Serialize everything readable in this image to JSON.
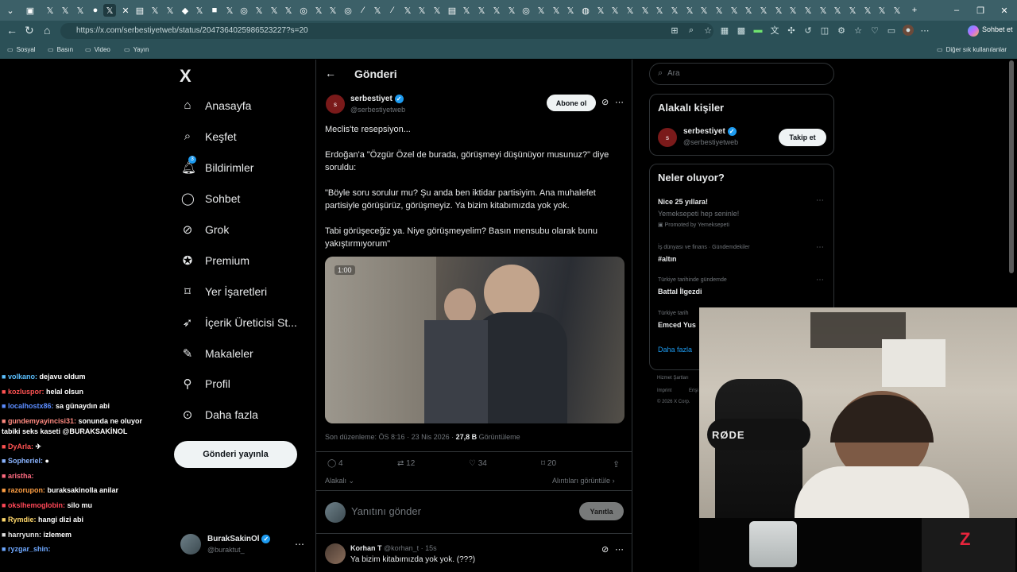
{
  "browser": {
    "url": "https://x.com/serbestiyetweb/status/2047364025986523227?s=20",
    "profile_button": "Sohbet et",
    "bookmarks": [
      "Sosyal",
      "Basın",
      "Video",
      "Yayın"
    ],
    "other_bookmarks": "Diğer sık kullanılanlar"
  },
  "nav": {
    "logo": "X",
    "items": [
      "Anasayfa",
      "Keşfet",
      "Bildirimler",
      "Sohbet",
      "Grok",
      "Premium",
      "Yer İşaretleri",
      "İçerik Üreticisi St...",
      "Makaleler",
      "Profil",
      "Daha fazla"
    ],
    "notif_badge": "3",
    "post_button": "Gönderi yayınla",
    "account_name": "BurakSakinOl",
    "account_handle": "@buraktut_"
  },
  "main": {
    "header_title": "Gönderi",
    "author_name": "serbestiyet",
    "author_handle": "@serbestiyetweb",
    "follow_button": "Abone ol",
    "text_1": "Meclis'te resepsiyon...",
    "text_2": "Erdoğan'a \"Özgür Özel de burada, görüşmeyi düşünüyor musunuz?\" diye soruldu:",
    "text_3": "\"Böyle soru sorulur mu? Şu anda ben iktidar partisiyim. Ana muhalefet partisiyle görüşürüz, görüşmeyiz. Ya bizim kitabımızda yok yok.",
    "text_4": "Tabi görüşeceğiz ya. Niye görüşmeyelim? Basın mensubu olarak bunu yakıştırmıyorum\"",
    "video_time": "1:00",
    "meta_prefix": "Son düzenleme: ÖS 8:16 · 23 Nis 2026 · ",
    "views_count": "27,8 B",
    "views_label": "Görüntüleme",
    "replies": "4",
    "reposts": "12",
    "likes": "34",
    "bookmarks": "20",
    "relevance": "Alakalı",
    "quotes_link": "Alıntıları görüntüle",
    "reply_placeholder": "Yanıtını gönder",
    "reply_button": "Yanıtla",
    "reply_author": "Korhan T",
    "reply_handle_time": "@korhan_t · 15s",
    "reply_text": "Ya bizim kitabımızda yok yok. (???)"
  },
  "right": {
    "search_placeholder": "Ara",
    "related_title": "Alakalı kişiler",
    "related_name": "serbestiyet",
    "related_handle": "@serbestiyetweb",
    "follow_button": "Takip et",
    "trends_title": "Neler oluyor?",
    "trend1_title": "Nice 25 yıllara!",
    "trend1_sub": "Yemeksepeti hep seninle!",
    "trend1_promo": "Promoted by Yemeksepeti",
    "trend2_ctx": "İş dünyası ve finans · Gündemdekiler",
    "trend2_title": "#altın",
    "trend3_ctx": "Türkiye tarihinde gündemde",
    "trend3_title": "Battal İlgezdi",
    "trend4_ctx": "Türkiye tarih",
    "trend4_title": "Emced Yus",
    "more": "Daha fazla",
    "footer1": "Hizmet Şartları",
    "footer2": "Imprint",
    "footer3": "Erişi",
    "footer4": "© 2026 X Corp."
  },
  "chat": [
    {
      "user": "volkano:",
      "msg": "dejavu oldum",
      "color": "#5bc0ff"
    },
    {
      "user": "kozluspor:",
      "msg": "helal olsun",
      "color": "#ff5252"
    },
    {
      "user": "localhostx86:",
      "msg": "sa günaydın abi",
      "color": "#5b8cff"
    },
    {
      "user": "gundemyayincisi31:",
      "msg": "sonunda ne oluyor tabiki seks kaseti @BURAKSAKİNOL",
      "color": "#ff8a80"
    },
    {
      "user": "DyArla:",
      "msg": "✈",
      "color": "#ff5252"
    },
    {
      "user": "Sopheriel:",
      "msg": "●",
      "color": "#8ab4ff"
    },
    {
      "user": "aristha:",
      "msg": "",
      "color": "#ff6b81"
    },
    {
      "user": "razorupon:",
      "msg": "buraksakinolla anilar",
      "color": "#ff9f43"
    },
    {
      "user": "okslhemoglobin:",
      "msg": "silo mu",
      "color": "#ff4757"
    },
    {
      "user": "Rymdie:",
      "msg": "hangi dizi abi",
      "color": "#ffd86b"
    },
    {
      "user": "harryunn:",
      "msg": "izlemem",
      "color": "#e0e0e0"
    },
    {
      "user": "ryzgar_shin:",
      "msg": "",
      "color": "#6ea8ff"
    }
  ],
  "webcam": {
    "mic_brand": "RØDE"
  }
}
